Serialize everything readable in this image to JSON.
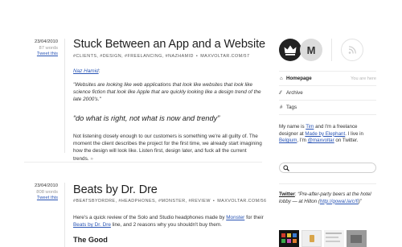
{
  "posts": [
    {
      "date": "23/04/2010",
      "words": "87 words",
      "tweet_link": "Tweet this",
      "title": "Stuck Between an App and a Website",
      "tags": [
        "#CLIENTS",
        "#DESIGN",
        "#FREELANCING",
        "#NAZHAMID"
      ],
      "permalink": "MAXVOLTAR.COM/57",
      "author_link": "Naz Hamid",
      "quote": "\"Websites are looking like web applications that look like websites that look like science fiction that look like Apple that are quickly looking like a design trend of the late 2000's.\"",
      "big_quote": "“do what is right, not what is now and trendy”",
      "paragraph": "Not listening closely enough to our customers is something we're all guilty of. The moment the client describes the project for the first time, we already start imagining how the design will look like. Listen first, design later, and fuck all the current trends.",
      "end_mark": "»"
    },
    {
      "date": "23/04/2010",
      "words": "808 words",
      "tweet_link": "Tweet this",
      "title": "Beats by Dr. Dre",
      "tags": [
        "#BEATSBYDRDRE",
        "#HEADPHONES",
        "#MONSTER",
        "#REVIEW"
      ],
      "permalink": "MAXVOLTAR.COM/56",
      "para_1": "Here's a quick review of the Solo and Studio headphones made by ",
      "para_link_1": "Monster",
      "para_2": " for their ",
      "para_link_2": "Beats by Dr. Dre",
      "para_3": " line, and 2 reasons why you shouldn't buy them.",
      "subheading": "The Good"
    }
  ],
  "sidebar": {
    "avatar_letter": "M",
    "nav": [
      {
        "icon": "home-icon",
        "glyph": "⌂",
        "label": "Homepage",
        "note": "You are here"
      },
      {
        "icon": "archive-icon",
        "glyph": "⁄⁄",
        "label": "Archive"
      },
      {
        "icon": "tags-icon",
        "glyph": "#",
        "label": "Tags"
      }
    ],
    "bio": {
      "t1": "My name is ",
      "name_link": "Tim",
      "t2": " and I'm a freelance designer at ",
      "company_link": "Made by Elephant",
      "t3": ". I live in ",
      "city_link": "Belgium",
      "t4": ", I'm ",
      "handle_link": "@maxvoltar",
      "t5": " on Twitter."
    },
    "twitter": {
      "label": "Twitter",
      "text": "“Pre-after-party beers at the hotel lobby — at Hilton",
      "link": "http://gowal.la/c/fi",
      "close": ")”"
    }
  },
  "colors": {
    "link": "#2a55b5",
    "dark_avatar": "#222222",
    "light_avatar": "#dcdcdc"
  }
}
